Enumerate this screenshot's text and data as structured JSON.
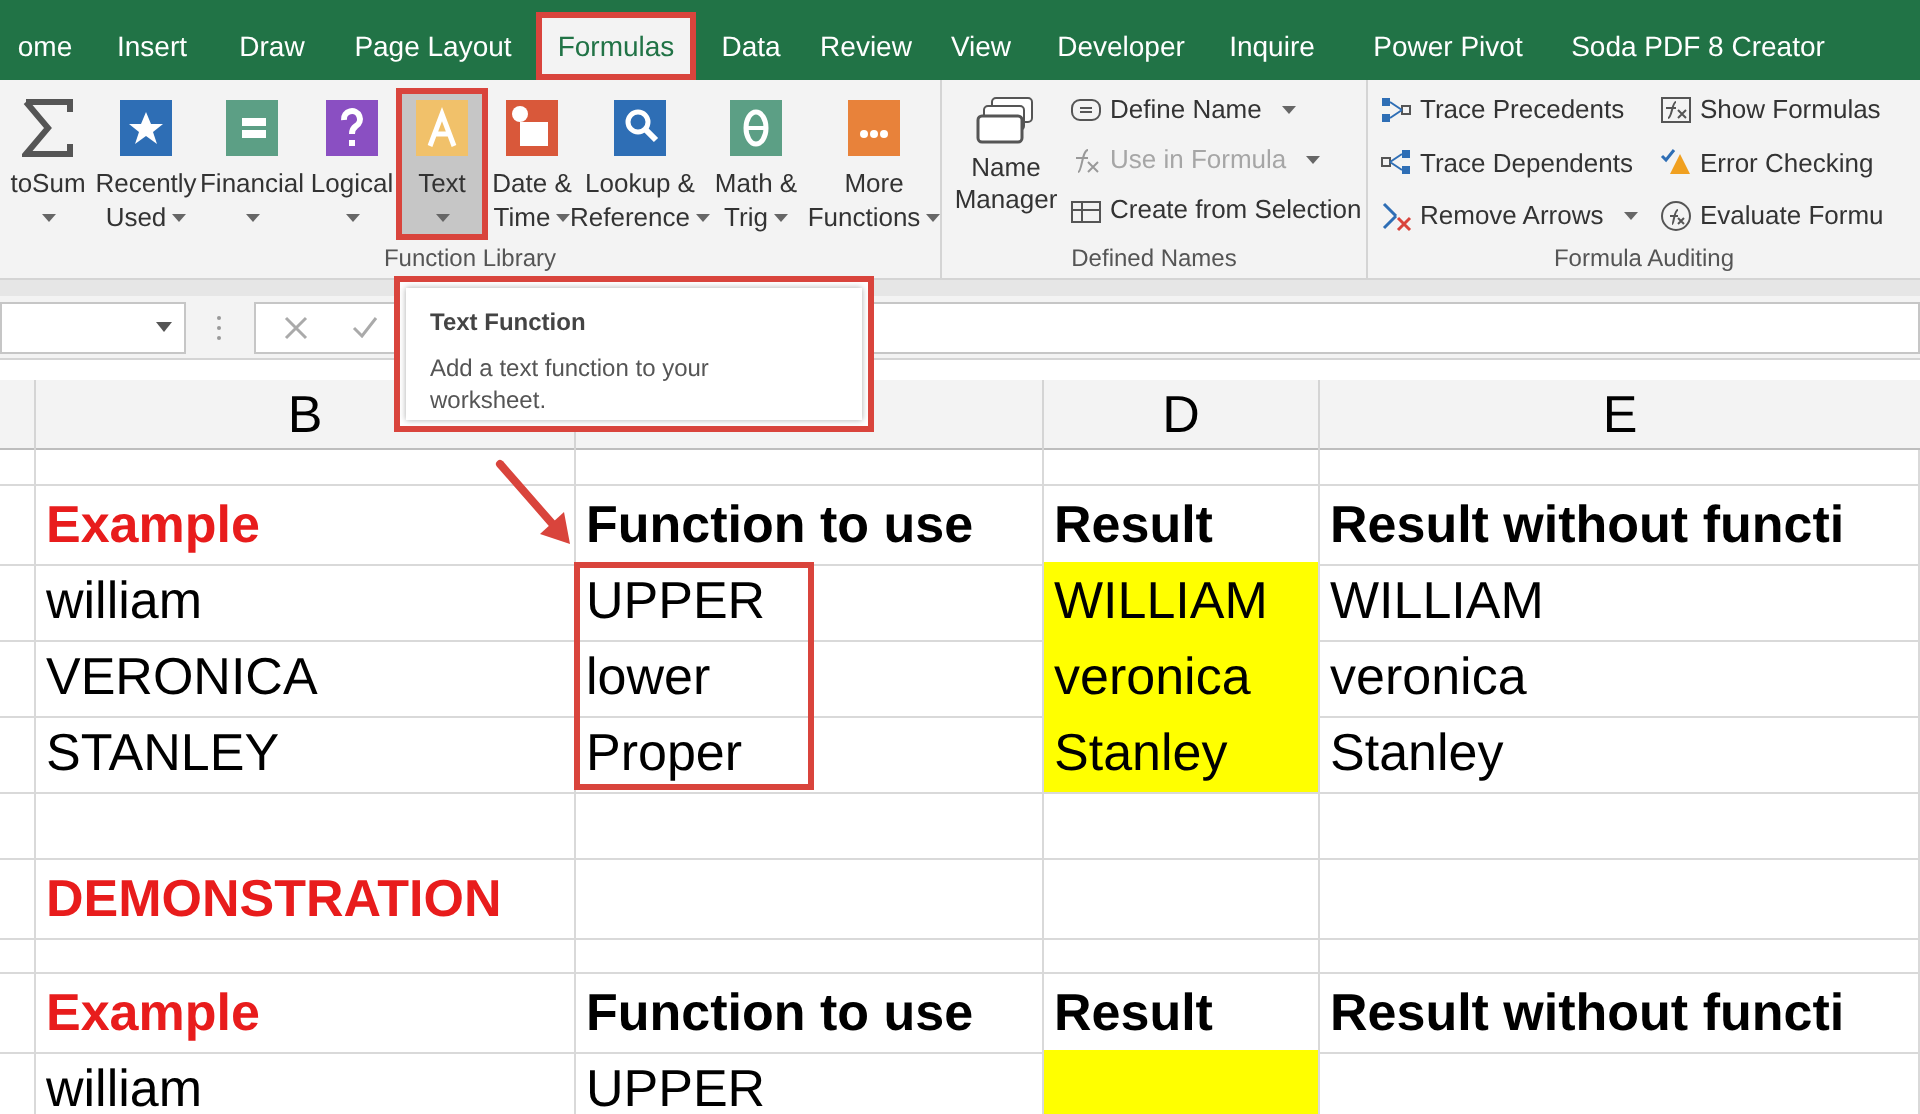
{
  "tabs": [
    {
      "label": "ome",
      "selected": false,
      "annotated": false
    },
    {
      "label": "Insert",
      "selected": false,
      "annotated": false
    },
    {
      "label": "Draw",
      "selected": false,
      "annotated": false
    },
    {
      "label": "Page Layout",
      "selected": false,
      "annotated": false
    },
    {
      "label": "Formulas",
      "selected": true,
      "annotated": true
    },
    {
      "label": "Data",
      "selected": false,
      "annotated": false
    },
    {
      "label": "Review",
      "selected": false,
      "annotated": false
    },
    {
      "label": "View",
      "selected": false,
      "annotated": false
    },
    {
      "label": "Developer",
      "selected": false,
      "annotated": false
    },
    {
      "label": "Inquire",
      "selected": false,
      "annotated": false
    },
    {
      "label": "Power Pivot",
      "selected": false,
      "annotated": false
    },
    {
      "label": "Soda PDF 8 Creator",
      "selected": false,
      "annotated": false
    }
  ],
  "function_library": {
    "label": "Function Library",
    "buttons": [
      {
        "kind": "sigma",
        "lines": [
          "toSum"
        ],
        "selected": false,
        "annotated": false
      },
      {
        "kind": "star",
        "lines": [
          "Recently",
          "Used"
        ],
        "selected": false,
        "annotated": false
      },
      {
        "kind": "coins",
        "lines": [
          "Financial"
        ],
        "selected": false,
        "annotated": false
      },
      {
        "kind": "question",
        "lines": [
          "Logical"
        ],
        "selected": false,
        "annotated": false
      },
      {
        "kind": "letter",
        "lines": [
          "Text"
        ],
        "selected": true,
        "annotated": true
      },
      {
        "kind": "calendar",
        "lines": [
          "Date &",
          "Time"
        ],
        "selected": false,
        "annotated": false
      },
      {
        "kind": "magnifier",
        "lines": [
          "Lookup &",
          "Reference"
        ],
        "selected": false,
        "annotated": false
      },
      {
        "kind": "theta",
        "lines": [
          "Math &",
          "Trig"
        ],
        "selected": false,
        "annotated": false
      },
      {
        "kind": "dots",
        "lines": [
          "More",
          "Functions"
        ],
        "selected": false,
        "annotated": false
      }
    ]
  },
  "defined_names": {
    "label": "Defined Names",
    "big_button": [
      "Name",
      "Manager"
    ],
    "items": [
      {
        "kind": "tag",
        "label": "Define Name",
        "dropdown": true,
        "disabled": false
      },
      {
        "kind": "fx",
        "label": "Use in Formula",
        "dropdown": true,
        "disabled": true
      },
      {
        "kind": "table",
        "label": "Create from Selection",
        "dropdown": false,
        "disabled": false
      }
    ]
  },
  "formula_auditing": {
    "label": "Formula Auditing",
    "items": [
      {
        "kind": "precedents",
        "label": "Trace Precedents",
        "dropdown": false,
        "disabled": false
      },
      {
        "kind": "dependents",
        "label": "Trace Dependents",
        "dropdown": false,
        "disabled": false
      },
      {
        "kind": "remove",
        "label": "Remove Arrows",
        "dropdown": true,
        "disabled": false
      },
      {
        "kind": "formulas",
        "label": "Show Formulas",
        "disabled": false
      },
      {
        "kind": "error",
        "label": "Error Checking",
        "disabled": false
      },
      {
        "kind": "evaluate",
        "label": "Evaluate Formu",
        "disabled": false
      }
    ]
  },
  "tooltip": {
    "title": "Text Function",
    "text": "Add a text function to your worksheet."
  },
  "column_headers": [
    "B",
    "D",
    "E"
  ],
  "rows": [
    {
      "kind": "blank",
      "cells": []
    },
    {
      "kind": "title",
      "cells": [
        {
          "text": "Example",
          "highlighted": false,
          "annotated": false
        },
        {
          "text": "Function to use",
          "highlighted": false,
          "annotated": false
        },
        {
          "text": "Result",
          "highlighted": false,
          "annotated": false
        },
        {
          "text": "Result without functi",
          "highlighted": false,
          "annotated": false
        }
      ]
    },
    {
      "kind": "data",
      "cells": [
        {
          "text": "william",
          "highlighted": false,
          "annotated": false
        },
        {
          "text": "UPPER",
          "highlighted": false,
          "annotated": true
        },
        {
          "text": "WILLIAM",
          "highlighted": true,
          "annotated": false
        },
        {
          "text": "WILLIAM",
          "highlighted": false,
          "annotated": false
        }
      ]
    },
    {
      "kind": "data",
      "cells": [
        {
          "text": "VERONICA",
          "highlighted": false,
          "annotated": false
        },
        {
          "text": "lower",
          "highlighted": false,
          "annotated": true
        },
        {
          "text": "veronica",
          "highlighted": true,
          "annotated": false
        },
        {
          "text": "veronica",
          "highlighted": false,
          "annotated": false
        }
      ]
    },
    {
      "kind": "data",
      "cells": [
        {
          "text": "STANLEY",
          "highlighted": false,
          "annotated": false
        },
        {
          "text": "Proper",
          "highlighted": false,
          "annotated": true
        },
        {
          "text": "Stanley",
          "highlighted": true,
          "annotated": false
        },
        {
          "text": "Stanley",
          "highlighted": false,
          "annotated": false
        }
      ]
    },
    {
      "kind": "blank",
      "cells": []
    },
    {
      "kind": "section",
      "cells": [
        {
          "text": "DEMONSTRATION",
          "highlighted": false,
          "annotated": false
        }
      ]
    },
    {
      "kind": "blank",
      "cells": []
    },
    {
      "kind": "title",
      "cells": [
        {
          "text": "Example",
          "highlighted": false,
          "annotated": false
        },
        {
          "text": "Function to use",
          "highlighted": false,
          "annotated": false
        },
        {
          "text": "Result",
          "highlighted": false,
          "annotated": false
        },
        {
          "text": "Result without functi",
          "highlighted": false,
          "annotated": false
        }
      ]
    },
    {
      "kind": "data",
      "cells": [
        {
          "text": "william",
          "highlighted": false,
          "annotated": false
        },
        {
          "text": "UPPER",
          "highlighted": false,
          "annotated": false
        },
        {
          "highlighted": true,
          "annotated": false
        },
        {
          "highlighted": false,
          "annotated": false
        }
      ]
    }
  ]
}
